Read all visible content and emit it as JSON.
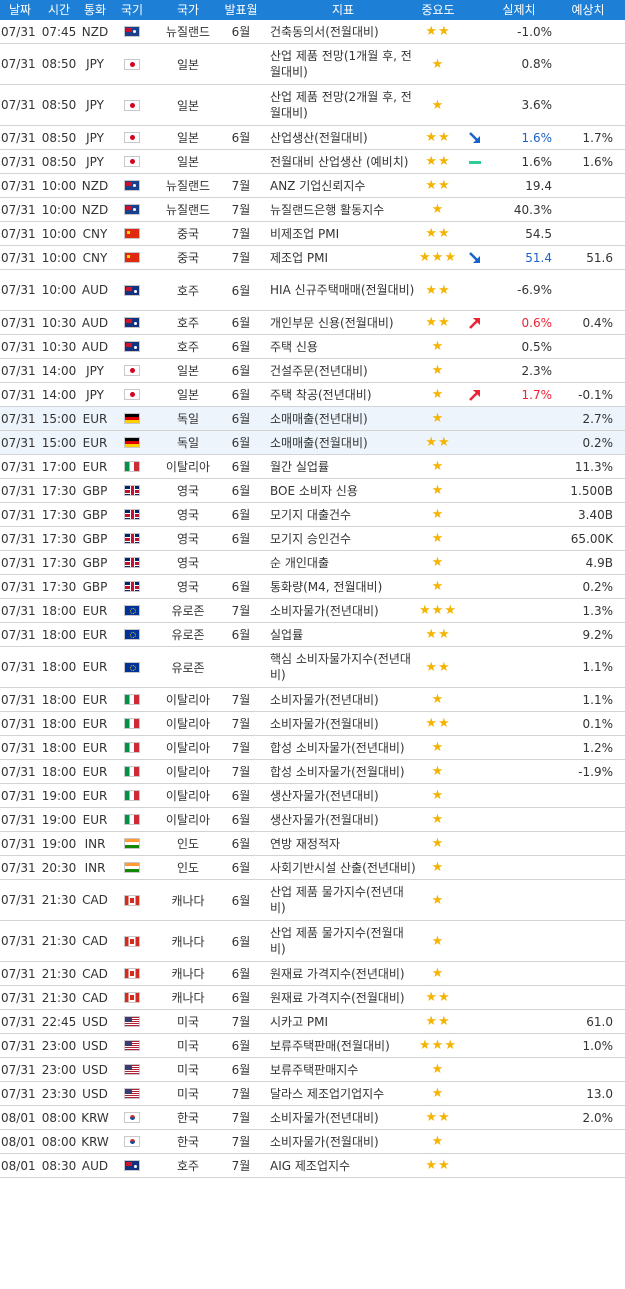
{
  "header": {
    "date": "날짜",
    "time": "시간",
    "currency": "통화",
    "flag": "국기",
    "country": "국가",
    "period": "발표월",
    "indicator": "지표",
    "importance": "중요도",
    "actual": "실제치",
    "forecast": "예상치"
  },
  "colors": {
    "header_bg": "#1e7fd6",
    "star": "#f4b400",
    "up": "#ee2233",
    "down": "#1a63c9",
    "flat": "#2ecc9a",
    "highlight_row": "#eef4fc"
  },
  "rows": [
    {
      "date": "07/31",
      "time": "07:45",
      "currency": "NZD",
      "flag": "nzd",
      "country": "뉴질랜드",
      "period": "6월",
      "indicator": "건축동의서(전월대비)",
      "importance": "★★",
      "trend": "",
      "actual": "-1.0%",
      "forecast": ""
    },
    {
      "date": "07/31",
      "time": "08:50",
      "currency": "JPY",
      "flag": "jpy",
      "country": "일본",
      "period": "",
      "indicator": "산업 제품 전망(1개월 후, 전월대비)",
      "importance": "★",
      "trend": "",
      "actual": "0.8%",
      "forecast": ""
    },
    {
      "date": "07/31",
      "time": "08:50",
      "currency": "JPY",
      "flag": "jpy",
      "country": "일본",
      "period": "",
      "indicator": "산업 제품 전망(2개월 후, 전월대비)",
      "importance": "★",
      "trend": "",
      "actual": "3.6%",
      "forecast": ""
    },
    {
      "date": "07/31",
      "time": "08:50",
      "currency": "JPY",
      "flag": "jpy",
      "country": "일본",
      "period": "6월",
      "indicator": "산업생산(전월대비)",
      "importance": "★★",
      "trend": "down",
      "actual": "1.6%",
      "forecast": "1.7%"
    },
    {
      "date": "07/31",
      "time": "08:50",
      "currency": "JPY",
      "flag": "jpy",
      "country": "일본",
      "period": "",
      "indicator": "전월대비 산업생산 (예비치)",
      "importance": "★★",
      "trend": "flat",
      "actual": "1.6%",
      "forecast": "1.6%"
    },
    {
      "date": "07/31",
      "time": "10:00",
      "currency": "NZD",
      "flag": "nzd",
      "country": "뉴질랜드",
      "period": "7월",
      "indicator": "ANZ 기업신뢰지수",
      "importance": "★★",
      "trend": "",
      "actual": "19.4",
      "forecast": ""
    },
    {
      "date": "07/31",
      "time": "10:00",
      "currency": "NZD",
      "flag": "nzd",
      "country": "뉴질랜드",
      "period": "7월",
      "indicator": "뉴질랜드은행 활동지수",
      "importance": "★",
      "trend": "",
      "actual": "40.3%",
      "forecast": ""
    },
    {
      "date": "07/31",
      "time": "10:00",
      "currency": "CNY",
      "flag": "cny",
      "country": "중국",
      "period": "7월",
      "indicator": "비제조업 PMI",
      "importance": "★★",
      "trend": "",
      "actual": "54.5",
      "forecast": ""
    },
    {
      "date": "07/31",
      "time": "10:00",
      "currency": "CNY",
      "flag": "cny",
      "country": "중국",
      "period": "7월",
      "indicator": "제조업 PMI",
      "importance": "★★★",
      "trend": "down",
      "actual": "51.4",
      "forecast": "51.6"
    },
    {
      "date": "07/31",
      "time": "10:00",
      "currency": "AUD",
      "flag": "aud",
      "country": "호주",
      "period": "6월",
      "indicator": "HIA 신규주택매매(전월대비)",
      "importance": "★★",
      "trend": "",
      "actual": "-6.9%",
      "forecast": ""
    },
    {
      "date": "07/31",
      "time": "10:30",
      "currency": "AUD",
      "flag": "aud",
      "country": "호주",
      "period": "6월",
      "indicator": "개인부문 신용(전월대비)",
      "importance": "★★",
      "trend": "up",
      "actual": "0.6%",
      "forecast": "0.4%"
    },
    {
      "date": "07/31",
      "time": "10:30",
      "currency": "AUD",
      "flag": "aud",
      "country": "호주",
      "period": "6월",
      "indicator": "주택 신용",
      "importance": "★",
      "trend": "",
      "actual": "0.5%",
      "forecast": ""
    },
    {
      "date": "07/31",
      "time": "14:00",
      "currency": "JPY",
      "flag": "jpy",
      "country": "일본",
      "period": "6월",
      "indicator": "건설주문(전년대비)",
      "importance": "★",
      "trend": "",
      "actual": "2.3%",
      "forecast": ""
    },
    {
      "date": "07/31",
      "time": "14:00",
      "currency": "JPY",
      "flag": "jpy",
      "country": "일본",
      "period": "6월",
      "indicator": "주택 착공(전년대비)",
      "importance": "★",
      "trend": "up",
      "actual": "1.7%",
      "forecast": "-0.1%"
    },
    {
      "date": "07/31",
      "time": "15:00",
      "currency": "EUR",
      "flag": "de",
      "country": "독일",
      "period": "6월",
      "indicator": "소매매출(전년대비)",
      "importance": "★",
      "trend": "",
      "actual": "",
      "forecast": "2.7%",
      "highlight": true
    },
    {
      "date": "07/31",
      "time": "15:00",
      "currency": "EUR",
      "flag": "de",
      "country": "독일",
      "period": "6월",
      "indicator": "소매매출(전월대비)",
      "importance": "★★",
      "trend": "",
      "actual": "",
      "forecast": "0.2%",
      "highlight": true
    },
    {
      "date": "07/31",
      "time": "17:00",
      "currency": "EUR",
      "flag": "it",
      "country": "이탈리아",
      "period": "6월",
      "indicator": "월간 실업률",
      "importance": "★",
      "trend": "",
      "actual": "",
      "forecast": "11.3%"
    },
    {
      "date": "07/31",
      "time": "17:30",
      "currency": "GBP",
      "flag": "gbp",
      "country": "영국",
      "period": "6월",
      "indicator": "BOE 소비자 신용",
      "importance": "★",
      "trend": "",
      "actual": "",
      "forecast": "1.500B"
    },
    {
      "date": "07/31",
      "time": "17:30",
      "currency": "GBP",
      "flag": "gbp",
      "country": "영국",
      "period": "6월",
      "indicator": "모기지 대출건수",
      "importance": "★",
      "trend": "",
      "actual": "",
      "forecast": "3.40B"
    },
    {
      "date": "07/31",
      "time": "17:30",
      "currency": "GBP",
      "flag": "gbp",
      "country": "영국",
      "period": "6월",
      "indicator": "모기지 승인건수",
      "importance": "★",
      "trend": "",
      "actual": "",
      "forecast": "65.00K"
    },
    {
      "date": "07/31",
      "time": "17:30",
      "currency": "GBP",
      "flag": "gbp",
      "country": "영국",
      "period": "",
      "indicator": "순 개인대출",
      "importance": "★",
      "trend": "",
      "actual": "",
      "forecast": "4.9B"
    },
    {
      "date": "07/31",
      "time": "17:30",
      "currency": "GBP",
      "flag": "gbp",
      "country": "영국",
      "period": "6월",
      "indicator": "통화량(M4, 전월대비)",
      "importance": "★",
      "trend": "",
      "actual": "",
      "forecast": "0.2%"
    },
    {
      "date": "07/31",
      "time": "18:00",
      "currency": "EUR",
      "flag": "eur",
      "country": "유로존",
      "period": "7월",
      "indicator": "소비자물가(전년대비)",
      "importance": "★★★",
      "trend": "",
      "actual": "",
      "forecast": "1.3%"
    },
    {
      "date": "07/31",
      "time": "18:00",
      "currency": "EUR",
      "flag": "eur",
      "country": "유로존",
      "period": "6월",
      "indicator": "실업률",
      "importance": "★★",
      "trend": "",
      "actual": "",
      "forecast": "9.2%"
    },
    {
      "date": "07/31",
      "time": "18:00",
      "currency": "EUR",
      "flag": "eur",
      "country": "유로존",
      "period": "",
      "indicator": "핵심 소비자물가지수(전년대비)",
      "importance": "★★",
      "trend": "",
      "actual": "",
      "forecast": "1.1%"
    },
    {
      "date": "07/31",
      "time": "18:00",
      "currency": "EUR",
      "flag": "it",
      "country": "이탈리아",
      "period": "7월",
      "indicator": "소비자물가(전년대비)",
      "importance": "★",
      "trend": "",
      "actual": "",
      "forecast": "1.1%"
    },
    {
      "date": "07/31",
      "time": "18:00",
      "currency": "EUR",
      "flag": "it",
      "country": "이탈리아",
      "period": "7월",
      "indicator": "소비자물가(전월대비)",
      "importance": "★★",
      "trend": "",
      "actual": "",
      "forecast": "0.1%"
    },
    {
      "date": "07/31",
      "time": "18:00",
      "currency": "EUR",
      "flag": "it",
      "country": "이탈리아",
      "period": "7월",
      "indicator": "합성 소비자물가(전년대비)",
      "importance": "★",
      "trend": "",
      "actual": "",
      "forecast": "1.2%"
    },
    {
      "date": "07/31",
      "time": "18:00",
      "currency": "EUR",
      "flag": "it",
      "country": "이탈리아",
      "period": "7월",
      "indicator": "합성 소비자물가(전월대비)",
      "importance": "★",
      "trend": "",
      "actual": "",
      "forecast": "-1.9%"
    },
    {
      "date": "07/31",
      "time": "19:00",
      "currency": "EUR",
      "flag": "it",
      "country": "이탈리아",
      "period": "6월",
      "indicator": "생산자물가(전년대비)",
      "importance": "★",
      "trend": "",
      "actual": "",
      "forecast": ""
    },
    {
      "date": "07/31",
      "time": "19:00",
      "currency": "EUR",
      "flag": "it",
      "country": "이탈리아",
      "period": "6월",
      "indicator": "생산자물가(전월대비)",
      "importance": "★",
      "trend": "",
      "actual": "",
      "forecast": ""
    },
    {
      "date": "07/31",
      "time": "19:00",
      "currency": "INR",
      "flag": "inr",
      "country": "인도",
      "period": "6월",
      "indicator": "연방 재정적자",
      "importance": "★",
      "trend": "",
      "actual": "",
      "forecast": ""
    },
    {
      "date": "07/31",
      "time": "20:30",
      "currency": "INR",
      "flag": "inr",
      "country": "인도",
      "period": "6월",
      "indicator": "사회기반시설 산출(전년대비)",
      "importance": "★",
      "trend": "",
      "actual": "",
      "forecast": ""
    },
    {
      "date": "07/31",
      "time": "21:30",
      "currency": "CAD",
      "flag": "cad",
      "country": "캐나다",
      "period": "6월",
      "indicator": "산업 제품 물가지수(전년대비)",
      "importance": "★",
      "trend": "",
      "actual": "",
      "forecast": ""
    },
    {
      "date": "07/31",
      "time": "21:30",
      "currency": "CAD",
      "flag": "cad",
      "country": "캐나다",
      "period": "6월",
      "indicator": "산업 제품 물가지수(전월대비)",
      "importance": "★",
      "trend": "",
      "actual": "",
      "forecast": ""
    },
    {
      "date": "07/31",
      "time": "21:30",
      "currency": "CAD",
      "flag": "cad",
      "country": "캐나다",
      "period": "6월",
      "indicator": "원재료 가격지수(전년대비)",
      "importance": "★",
      "trend": "",
      "actual": "",
      "forecast": ""
    },
    {
      "date": "07/31",
      "time": "21:30",
      "currency": "CAD",
      "flag": "cad",
      "country": "캐나다",
      "period": "6월",
      "indicator": "원재료 가격지수(전월대비)",
      "importance": "★★",
      "trend": "",
      "actual": "",
      "forecast": ""
    },
    {
      "date": "07/31",
      "time": "22:45",
      "currency": "USD",
      "flag": "usd",
      "country": "미국",
      "period": "7월",
      "indicator": "시카고 PMI",
      "importance": "★★",
      "trend": "",
      "actual": "",
      "forecast": "61.0"
    },
    {
      "date": "07/31",
      "time": "23:00",
      "currency": "USD",
      "flag": "usd",
      "country": "미국",
      "period": "6월",
      "indicator": "보류주택판매(전월대비)",
      "importance": "★★★",
      "trend": "",
      "actual": "",
      "forecast": "1.0%"
    },
    {
      "date": "07/31",
      "time": "23:00",
      "currency": "USD",
      "flag": "usd",
      "country": "미국",
      "period": "6월",
      "indicator": "보류주택판매지수",
      "importance": "★",
      "trend": "",
      "actual": "",
      "forecast": ""
    },
    {
      "date": "07/31",
      "time": "23:30",
      "currency": "USD",
      "flag": "usd",
      "country": "미국",
      "period": "7월",
      "indicator": "달라스 제조업기업지수",
      "importance": "★",
      "trend": "",
      "actual": "",
      "forecast": "13.0"
    },
    {
      "date": "08/01",
      "time": "08:00",
      "currency": "KRW",
      "flag": "krw",
      "country": "한국",
      "period": "7월",
      "indicator": "소비자물가(전년대비)",
      "importance": "★★",
      "trend": "",
      "actual": "",
      "forecast": "2.0%"
    },
    {
      "date": "08/01",
      "time": "08:00",
      "currency": "KRW",
      "flag": "krw",
      "country": "한국",
      "period": "7월",
      "indicator": "소비자물가(전월대비)",
      "importance": "★",
      "trend": "",
      "actual": "",
      "forecast": ""
    },
    {
      "date": "08/01",
      "time": "08:30",
      "currency": "AUD",
      "flag": "aud",
      "country": "호주",
      "period": "7월",
      "indicator": "AIG 제조업지수",
      "importance": "★★",
      "trend": "",
      "actual": "",
      "forecast": ""
    }
  ]
}
